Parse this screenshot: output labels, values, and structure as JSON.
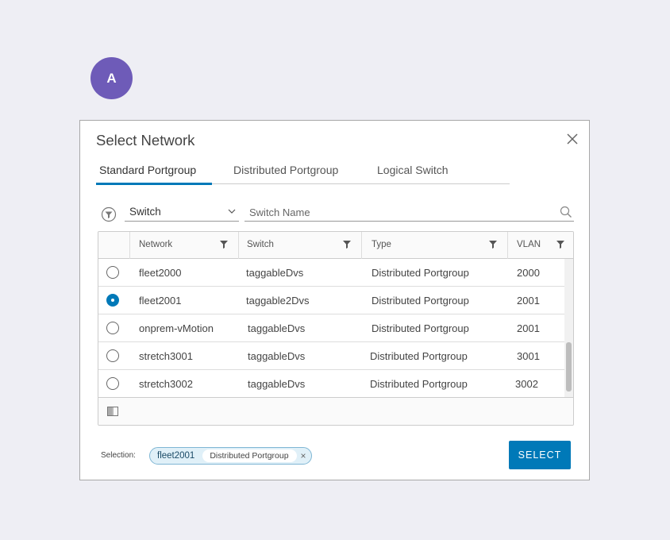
{
  "badge": {
    "letter": "A",
    "color": "#6e5bb8"
  },
  "dialog": {
    "title": "Select Network",
    "close_icon": "close-icon"
  },
  "tabs": [
    {
      "label": "Standard Portgroup",
      "active": true
    },
    {
      "label": "Distributed Portgroup",
      "active": false
    },
    {
      "label": "Logical Switch",
      "active": false
    }
  ],
  "filter": {
    "filter_icon": "filter-circle-icon",
    "select_value": "Switch",
    "search_placeholder": "Switch Name",
    "search_value": "",
    "search_icon": "search-icon"
  },
  "grid": {
    "columns": [
      "Network",
      "Switch",
      "Type",
      "VLAN"
    ],
    "rows": [
      {
        "network": "fleet2000",
        "switch": "taggableDvs",
        "type": "Distributed Portgroup",
        "vlan": "2000",
        "selected": false
      },
      {
        "network": "fleet2001",
        "switch": "taggable2Dvs",
        "type": "Distributed Portgroup",
        "vlan": "2001",
        "selected": true
      },
      {
        "network": "onprem-vMotion",
        "switch": "taggableDvs",
        "type": "Distributed Portgroup",
        "vlan": "2001",
        "selected": false
      },
      {
        "network": "stretch3001",
        "switch": "taggableDvs",
        "type": "Distributed Portgroup",
        "vlan": "3001",
        "selected": false
      },
      {
        "network": "stretch3002",
        "switch": "taggableDvs",
        "type": "Distributed Portgroup",
        "vlan": "3002",
        "selected": false
      }
    ],
    "footer_icon": "column-toggle-icon"
  },
  "selection": {
    "label": "Selection:",
    "name": "fleet2001",
    "type": "Distributed Portgroup",
    "remove": "×"
  },
  "actions": {
    "select_label": "SELECT"
  },
  "colors": {
    "accent": "#0079b8",
    "background": "#eeeef4"
  }
}
